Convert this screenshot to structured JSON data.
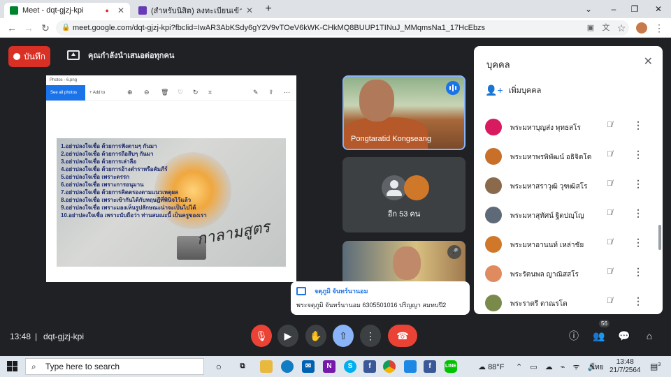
{
  "browser": {
    "tabs": [
      {
        "title": "Meet - dqt-gjzj-kpi",
        "active": true
      },
      {
        "title": "(สำหรับนิสิต) ลงทะเบียนเข้าร่วมกิจกรรม",
        "active": false
      }
    ],
    "new_tab": "+",
    "url": "meet.google.com/dqt-gjzj-kpi?fbclid=IwAR3AbKSdy6gY2V9vTOeV6kWK-CHkMQ8BUUP1TINuJ_MMqmsNa1_17HcEbzs"
  },
  "meet": {
    "record_label": "บันทึก",
    "presenting_banner": "คุณกำลังนำเสนอต่อทุกคน",
    "shared_window": {
      "title": "Photos - 6.png",
      "see_all": "See all photos",
      "add_to": "+ Add to",
      "slide_items": [
        "1.อย่าปลงใจเชื่อ ด้วยการฟังตามๆ กันมา",
        "2.อย่าปลงใจเชื่อ ด้วยการถือสืบๆ กันมา",
        "3.อย่าปลงใจเชื่อ ด้วยการเล่าลือ",
        "4.อย่าปลงใจเชื่อ ด้วยการอ้างตำราหรือคัมภีร์",
        "5.อย่าปลงใจเชื่อ เพราะตรรก",
        "6.อย่าปลงใจเชื่อ เพราะการอนุมาน",
        "7.อย่าปลงใจเชื่อ ด้วยการคิดตรองตามแนวเหตุผล",
        "8.อย่าปลงใจเชื่อ เพราะเข้ากันได้กับทฤษฎีที่พินิจไว้แล้ว",
        "9.อย่าปลงใจเชื่อ เพราะมองเห็นรูปลักษณะน่าจะเป็นไปได้",
        "10.อย่าปลงใจเชื่อ เพราะนับถือว่า ท่านสมณะนี้ เป็นครูของเรา"
      ],
      "slide_signature": "กาลามสูตร"
    },
    "tiles": {
      "speaker_name": "Pongtaratid Kongseang",
      "others_label": "อีก 53 คน"
    },
    "chat_notification": {
      "sender": "จตุภูมิ จันทร์นานอม",
      "message": "พระจตุภูมิ จันทร์นานอม 6305501016 ปริญญา สมทบปี2"
    },
    "people_panel": {
      "title": "บุคคล",
      "add_people": "เพิ่มบุคคล",
      "people": [
        {
          "name": "พระมหาบุญส่ง พุทธสโร",
          "avatar_color": "#d81b60"
        },
        {
          "name": "พระมหาพรพิพัฒน์ อธิจิตโต",
          "avatar_color": "#c8702a"
        },
        {
          "name": "พระมหาสราวุฒิ วุฑฒิสโร",
          "avatar_color": "#8a6a4a"
        },
        {
          "name": "พระมหาสุทัศน์ ฐิตปญฺโญ",
          "avatar_color": "#5f6a78"
        },
        {
          "name": "พระมหาอานนท์ เหล่าชัย",
          "avatar_color": "#d0782a"
        },
        {
          "name": "พระรัตนพล ญาณิสสโร",
          "avatar_color": "#e08a60"
        },
        {
          "name": "พระราตรี ตาณรโต",
          "avatar_color": "#7a8a4a"
        }
      ]
    },
    "bottom_bar": {
      "time": "13:48",
      "meeting_code": "dqt-gjzj-kpi",
      "participant_count": "56"
    },
    "colors": {
      "record": "#d93025",
      "end_call": "#ea4335",
      "accent": "#8ab4f8"
    }
  },
  "taskbar": {
    "search_placeholder": "Type here to search",
    "weather": "88°F",
    "language": "ไทย",
    "clock_time": "13:48",
    "clock_date": "21/7/2564",
    "notification_count": "3"
  }
}
